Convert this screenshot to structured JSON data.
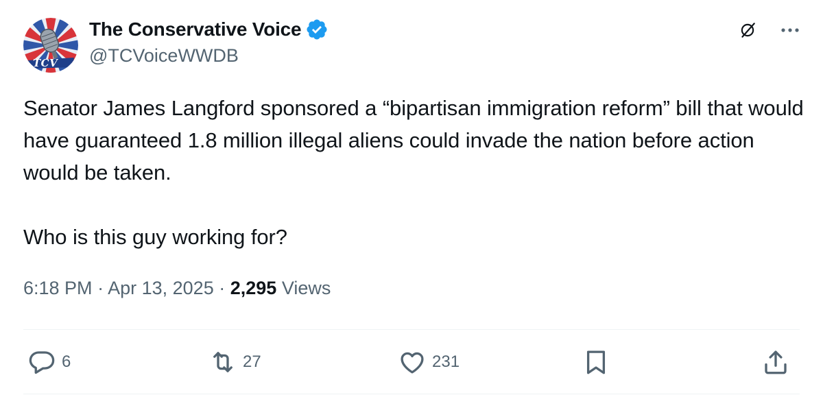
{
  "author": {
    "display_name": "The Conservative Voice",
    "handle": "@TCVoiceWWDB",
    "verified": true,
    "avatar_text": "TCV",
    "avatar_icon": "microphone-logo"
  },
  "tweet": {
    "paragraph_1": "Senator James Langford sponsored a “bipartisan immigration reform” bill that would have guaranteed 1.8 million illegal aliens could invade the nation before action would be taken.",
    "paragraph_2": "Who is this guy working for?"
  },
  "meta": {
    "time": "6:18 PM",
    "separator": "·",
    "date": "Apr 13, 2025",
    "views_count": "2,295",
    "views_label": "Views"
  },
  "actions": {
    "replies": "6",
    "reposts": "27",
    "likes": "231"
  },
  "colors": {
    "text_primary": "#0f1419",
    "text_secondary": "#536471",
    "verified_blue": "#1d9bf0",
    "divider": "#eff3f4"
  },
  "icons": {
    "verified": "verified-badge-icon",
    "grok": "grok-icon",
    "more": "more-icon",
    "reply": "reply-icon",
    "repost": "repost-icon",
    "like": "heart-icon",
    "bookmark": "bookmark-icon",
    "share": "share-icon"
  }
}
